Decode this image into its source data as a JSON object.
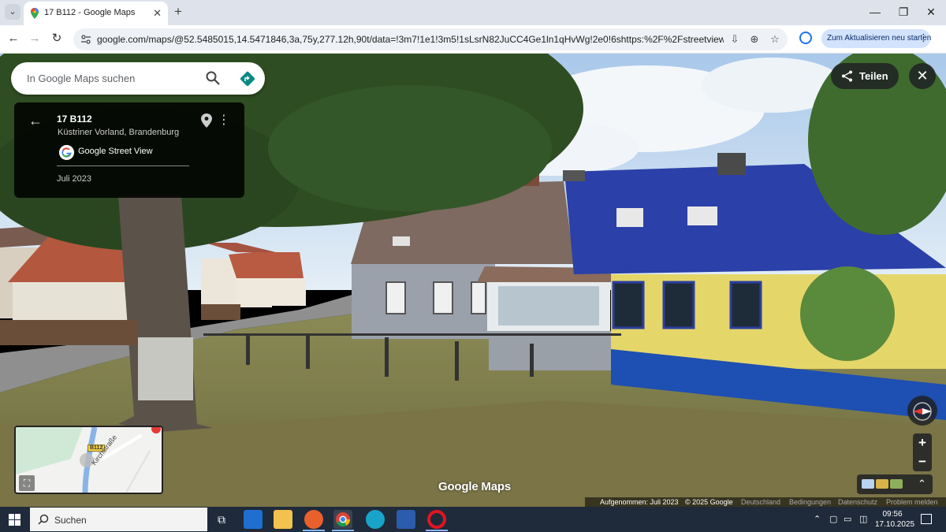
{
  "browser": {
    "tab_title": "17 B112 - Google Maps",
    "new_tab": "+",
    "url": "google.com/maps/@52.5485015,14.5471846,3a,75y,277.12h,90t/data=!3m7!1e1!3m5!1sLsrN82JuCC4Ge1ln1qHvWg!2e0!6shttps:%2F%2Fstreetviewpixels-pa.google...",
    "update_label": "Zum Aktualisieren neu starten",
    "window_controls": [
      "—",
      "❐",
      "✕"
    ]
  },
  "maps": {
    "search_placeholder": "In Google Maps suchen",
    "place_title": "17 B112",
    "place_subtitle": "Küstriner Vorland, Brandenburg",
    "street_view_label": "Google Street View",
    "capture_date": "Juli 2023",
    "share_label": "Teilen",
    "zoom_in": "+",
    "zoom_out": "−",
    "minimap": {
      "road_badge": "B112",
      "road_name": "Kirchstraße"
    },
    "watermark": "Google Maps",
    "attribution": {
      "captured": "Aufgenommen: Juli 2023",
      "copyright": "© 2025 Google",
      "country": "Deutschland",
      "terms": "Bedingungen",
      "privacy": "Datenschutz",
      "report": "Problem melden"
    }
  },
  "taskbar": {
    "search_label": "Suchen",
    "time": "09:56",
    "date": "17.10.2025"
  },
  "colors": {
    "maps_blue": "#1a73e8",
    "directions_teal": "#0b8a84",
    "sky": "#bcd6ee",
    "roof_blue": "#2a3fa6",
    "wall_yellow": "#e7d86a",
    "fence_blue": "#1f4fb0"
  }
}
